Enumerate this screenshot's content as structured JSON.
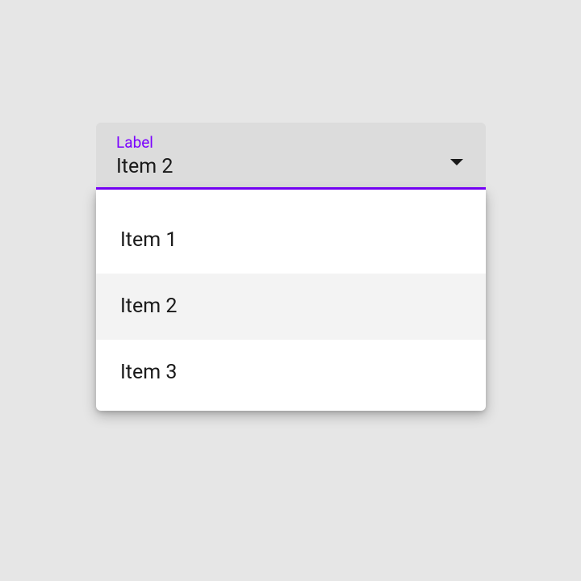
{
  "select": {
    "label": "Label",
    "value": "Item 2",
    "options": [
      {
        "label": "Item 1"
      },
      {
        "label": "Item 2"
      },
      {
        "label": "Item 3"
      }
    ],
    "selectedIndex": 1
  }
}
